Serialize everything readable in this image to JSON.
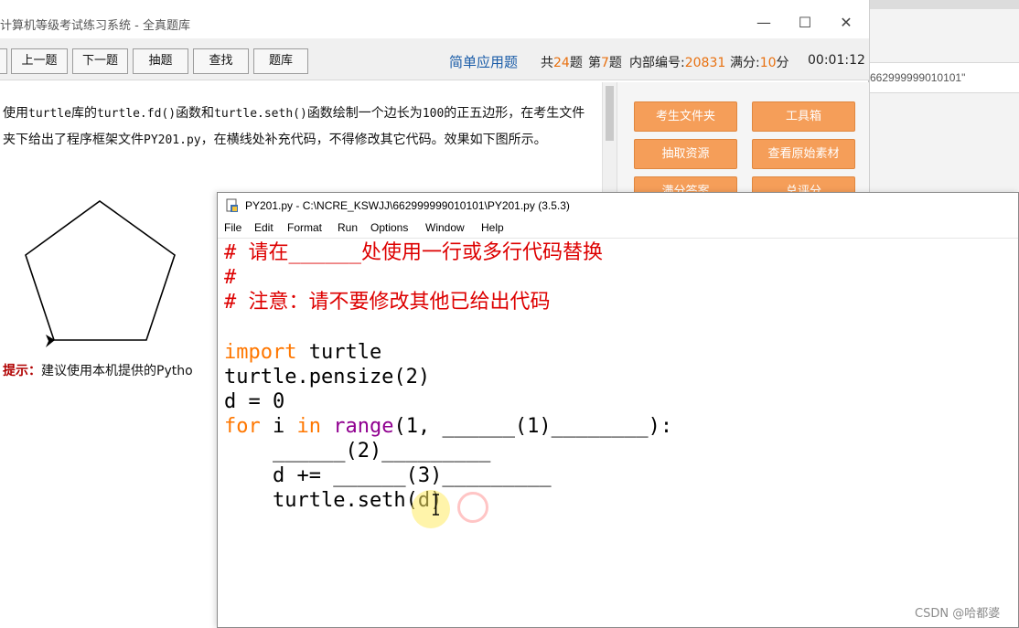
{
  "background_window": {
    "field_text": "662999999010101\""
  },
  "exam_window": {
    "title": "计算机等级考试练习系统 - 全真题库",
    "toolbar": {
      "prev": "上一题",
      "next": "下一题",
      "draw": "抽题",
      "find": "查找",
      "bank": "题库"
    },
    "qtype": "简单应用题",
    "total_prefix": "共",
    "total": "24",
    "total_suffix": "题",
    "index_prefix": "第",
    "index": "7",
    "index_suffix": "题",
    "code_label": "内部编号:",
    "code": "20831",
    "score_label": "满分:",
    "score": "10",
    "score_suffix": "分",
    "timer": "00:01:12",
    "question": {
      "p1": "使用",
      "c1": "turtle",
      "p2": "库的",
      "c2": "turtle.fd()",
      "p3": "函数和",
      "c3": "turtle.seth()",
      "p4": "函数绘制一个边长为",
      "c4": "100",
      "p5": "的正五边形，在考生文件夹下给出了程序框架文件",
      "c5": "PY201.py",
      "p6": "，在横线处补充代码，不得修改其它代码。效果如下图所示。"
    },
    "hint_label": "提示：",
    "hint_text": "建议使用本机提供的Pytho",
    "buttons": {
      "student_folder": "考生文件夹",
      "toolbox": "工具箱",
      "extract": "抽取资源",
      "view_source": "查看原始素材",
      "full_answer": "满分答案",
      "total_score": "总评分"
    }
  },
  "idle": {
    "title": "PY201.py - C:\\NCRE_KSWJJ\\662999999010101\\PY201.py (3.5.3)",
    "menu": [
      "File",
      "Edit",
      "Format",
      "Run",
      "Options",
      "Window",
      "Help"
    ],
    "code": {
      "l1": "# 请在______处使用一行或多行代码替换",
      "l2": "#",
      "l3": "# 注意：请不要修改其他已给出代码",
      "l5_kw": "import",
      "l5_rest": " turtle",
      "l6": "turtle.pensize(2)",
      "l7": "d = 0",
      "l8_for": "for",
      "l8_i": " i ",
      "l8_in": "in",
      "l8_sp": " ",
      "l8_range": "range",
      "l8_rest": "(1, ______(1)________):",
      "l9": "    ______(2)_________",
      "l10": "    d += ______(3)_________",
      "l11": "    turtle.seth(d)"
    }
  },
  "watermark": "CSDN @哈都婆"
}
